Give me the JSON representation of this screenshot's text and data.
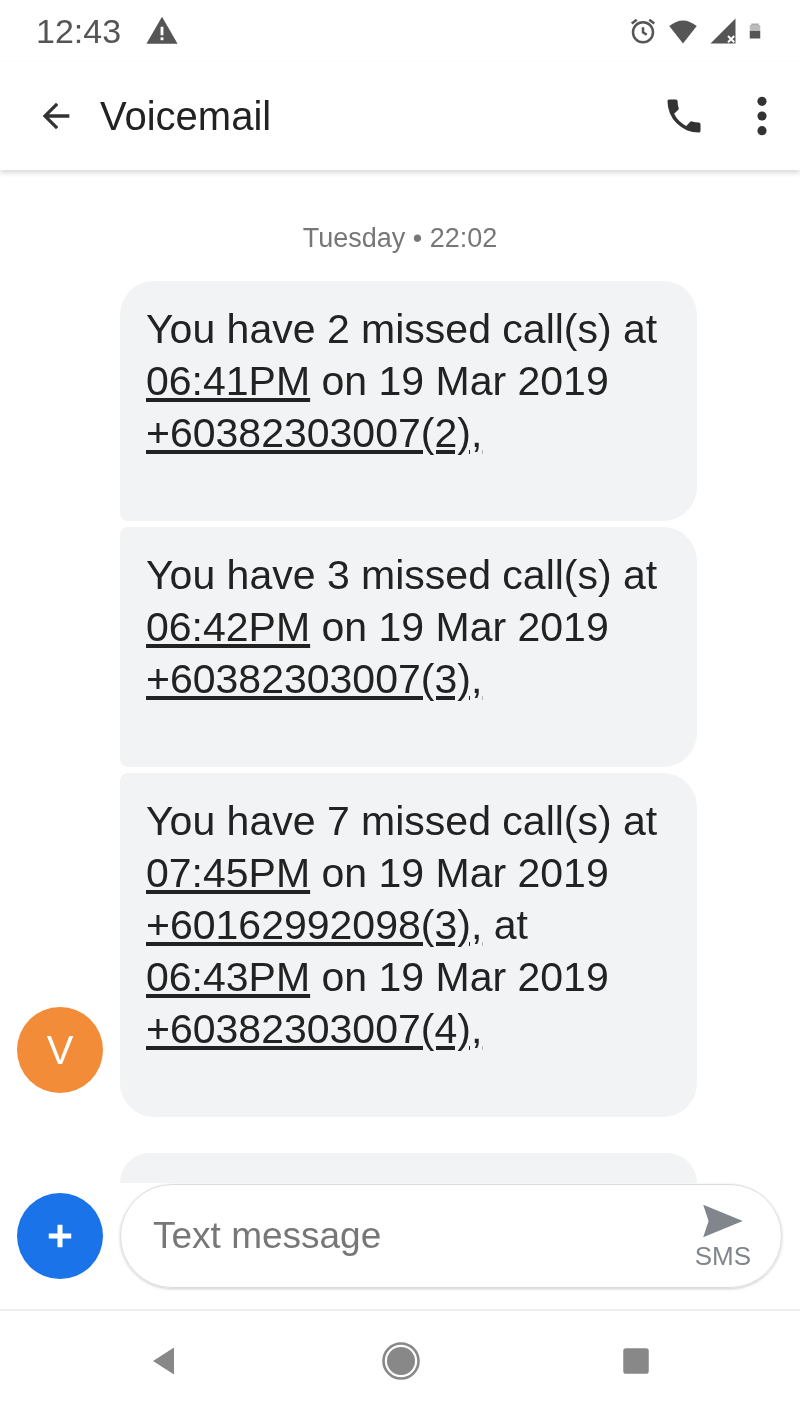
{
  "status_bar": {
    "time": "12:43"
  },
  "app_bar": {
    "title": "Voicemail"
  },
  "date_divider": "Tuesday • 22:02",
  "messages": [
    {
      "segments": [
        {
          "text": "You have 2 missed call(s) at "
        },
        {
          "text": "06:41PM",
          "link": true
        },
        {
          "text": " on 19 Mar 2019 "
        },
        {
          "text": "+60382303007(2),",
          "link": true
        }
      ]
    },
    {
      "segments": [
        {
          "text": "You have 3 missed call(s) at "
        },
        {
          "text": "06:42PM",
          "link": true
        },
        {
          "text": " on 19 Mar 2019 "
        },
        {
          "text": "+60382303007(3),",
          "link": true
        }
      ]
    },
    {
      "segments": [
        {
          "text": "You have 7 missed call(s) at "
        },
        {
          "text": "07:45PM",
          "link": true
        },
        {
          "text": " on 19 Mar 2019 "
        },
        {
          "text": "+60162992098(3),",
          "link": true
        },
        {
          "text": " at "
        },
        {
          "text": "06:43PM",
          "link": true
        },
        {
          "text": " on 19 Mar 2019 "
        },
        {
          "text": "+60382303007(4),",
          "link": true
        }
      ]
    }
  ],
  "sender_avatar": {
    "initial": "V",
    "color": "#f28c38"
  },
  "compose": {
    "placeholder": "Text message",
    "send_label": "SMS"
  }
}
